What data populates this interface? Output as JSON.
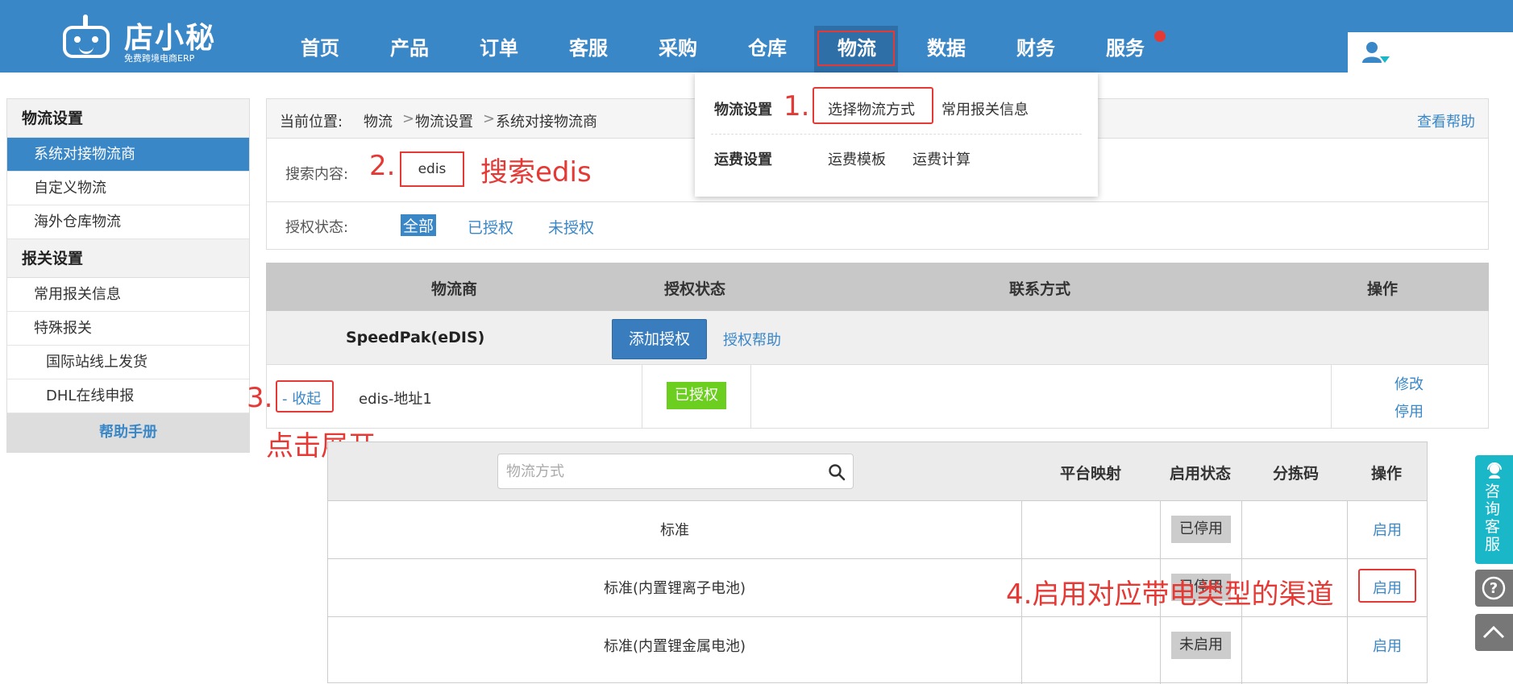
{
  "header": {
    "logo_name": "店小秘",
    "logo_sub": "免费跨境电商ERP",
    "nav": [
      "首页",
      "产品",
      "订单",
      "客服",
      "采购",
      "仓库",
      "物流",
      "数据",
      "财务",
      "服务"
    ],
    "active_nav": "物流",
    "notification_dot_color": "#e53935"
  },
  "dropdown": {
    "group1_label": "物流设置",
    "group1_items": [
      "选择物流方式",
      "常用报关信息"
    ],
    "group2_label": "运费设置",
    "group2_items": [
      "运费模板",
      "运费计算"
    ]
  },
  "sidebar": {
    "section1": "物流设置",
    "items1": [
      "系统对接物流商",
      "自定义物流",
      "海外仓库物流"
    ],
    "section2": "报关设置",
    "items2": [
      "常用报关信息",
      "特殊报关",
      "国际站线上发货",
      "DHL在线申报"
    ],
    "help": "帮助手册"
  },
  "breadcrumb": {
    "prefix": "当前位置:",
    "b1": "物流",
    "b2": "物流设置",
    "b3": "系统对接物流商",
    "sep": ">",
    "help_link": "查看帮助"
  },
  "search": {
    "label": "搜索内容:",
    "value": "edis",
    "auth_label": "授权状态:",
    "filters": [
      "全部",
      "已授权",
      "未授权"
    ]
  },
  "table1": {
    "headers": [
      "物流商",
      "授权状态",
      "联系方式",
      "操作"
    ],
    "carrier": "SpeedPak(eDIS)",
    "add_auth": "添加授权",
    "auth_help": "授权帮助",
    "collapse": "- 收起",
    "account": "edis-地址1",
    "auth_status": "已授权",
    "ops": [
      "修改",
      "停用"
    ]
  },
  "table2": {
    "placeholder": "物流方式",
    "headers": [
      "平台映射",
      "启用状态",
      "分拣码",
      "操作"
    ],
    "rows": [
      {
        "name": "标准",
        "status": "已停用",
        "op": "启用"
      },
      {
        "name": "标准(内置锂离子电池)",
        "status": "已停用",
        "op": "启用"
      },
      {
        "name": "标准(内置锂金属电池)",
        "status": "未启用",
        "op": "启用"
      }
    ]
  },
  "annotations": {
    "a1": "1.",
    "a2": "2.",
    "a2_text": "搜索edis",
    "a3": "3.",
    "a3_text": "点击展开",
    "a4_text": "4.启用对应带电类型的渠道"
  },
  "float": {
    "consult": "咨询客服",
    "question": "?"
  },
  "colors": {
    "brand_blue": "#3a87c8",
    "annotation_red": "#e53935",
    "authorized_green": "#6ccf1f",
    "consult_teal": "#1ab7c8"
  }
}
